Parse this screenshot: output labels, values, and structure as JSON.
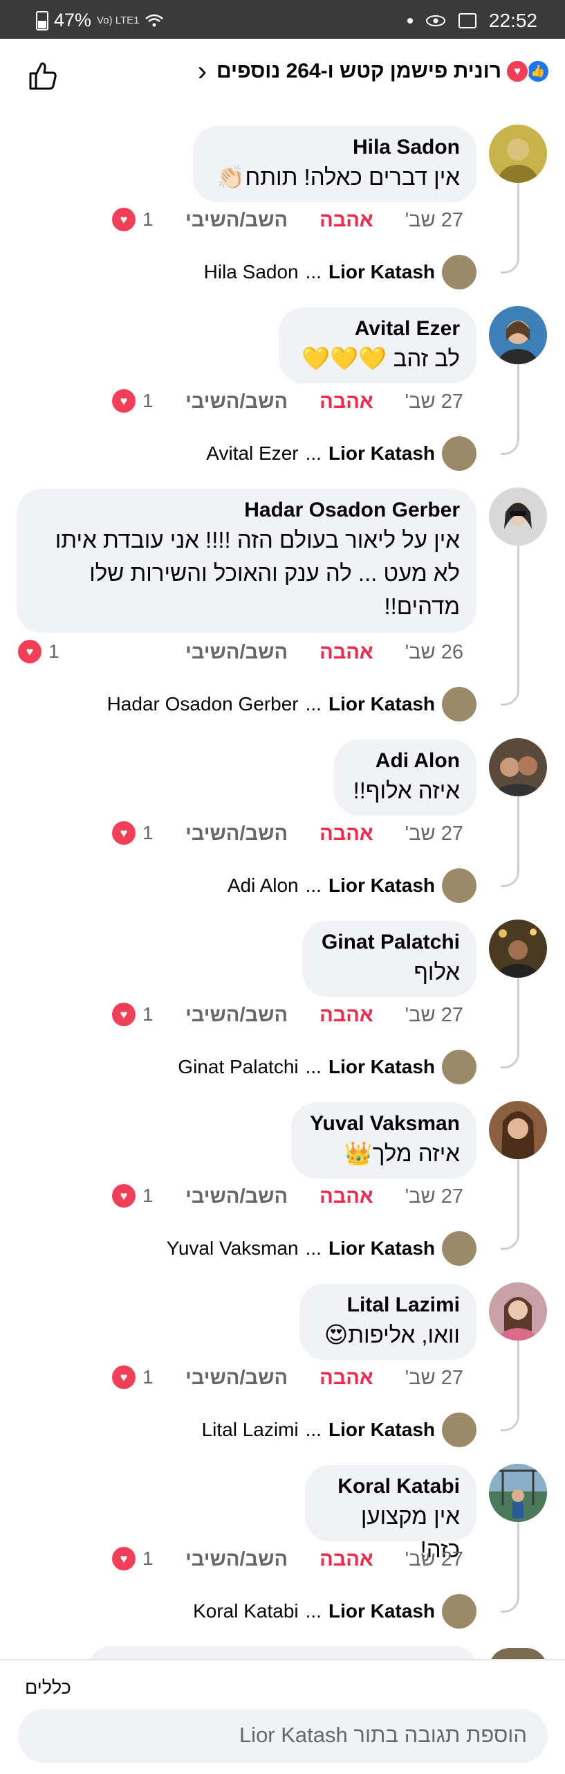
{
  "status_bar": {
    "battery": "47%",
    "network": "Vo) LTE1",
    "time": "22:52"
  },
  "header": {
    "title": "רונית פישמן קטש ו-264 נוספים"
  },
  "actions": {
    "love_label": "אהבה",
    "reply_label": "השב/השיבי"
  },
  "reply_preview": {
    "replier": "Lior Katash",
    "ellipsis": "..."
  },
  "comments": [
    {
      "author": "Hila Sadon",
      "text": "אין דברים כאלה! תותח👏🏻",
      "date": "27 שב'",
      "reaction_count": "1",
      "reply_to": "Hila Sadon",
      "avatar_color": "#c8b24a"
    },
    {
      "author": "Avital Ezer",
      "text": "לב זהב 💛💛💛",
      "date": "27 שב'",
      "reaction_count": "1",
      "reply_to": "Avital Ezer",
      "avatar_color": "#3d7fb8"
    },
    {
      "author": "Hadar Osadon Gerber",
      "text": "אין על ליאור בעולם הזה !!!! אני עובדת איתו לא מעט ... לה ענק והאוכל והשירות שלו מדהים!!",
      "date": "26 שב'",
      "reaction_count": "1",
      "reply_to": "Hadar Osadon Gerber",
      "avatar_color": "#9a9a9a"
    },
    {
      "author": "Adi Alon",
      "text": "איזה אלוף!!",
      "date": "27 שב'",
      "reaction_count": "1",
      "reply_to": "Adi Alon",
      "avatar_color": "#5a4a3c"
    },
    {
      "author": "Ginat Palatchi",
      "text": "אלוף",
      "date": "27 שב'",
      "reaction_count": "1",
      "reply_to": "Ginat Palatchi",
      "avatar_color": "#4a3a22"
    },
    {
      "author": "Yuval Vaksman",
      "text": "איזה מלך👑",
      "date": "27 שב'",
      "reaction_count": "1",
      "reply_to": "Yuval Vaksman",
      "avatar_color": "#8a6040"
    },
    {
      "author": "Lital Lazimi",
      "text": "וואו, אליפות😍",
      "date": "27 שב'",
      "reaction_count": "1",
      "reply_to": "Lital Lazimi",
      "avatar_color": "#c8a0a8"
    },
    {
      "author": "Koral Katabi",
      "text": "אין מקצוען כזה!",
      "date": "27 שב'",
      "reaction_count": "1",
      "reply_to": "Koral Katabi",
      "avatar_color": "#4a7a5a"
    }
  ],
  "composer": {
    "rules_label": "כללים",
    "placeholder": "הוספת תגובה בתור Lior Katash"
  },
  "colors": {
    "love": "#f02849",
    "like": "#1877f2",
    "bubble": "#f0f2f5",
    "meta": "#65676b"
  },
  "icons": [
    "battery-icon",
    "wifi-icon",
    "gallery-icon",
    "like-outline-icon",
    "chevron-left-icon",
    "like-reaction-icon",
    "love-reaction-icon",
    "heart-icon"
  ]
}
